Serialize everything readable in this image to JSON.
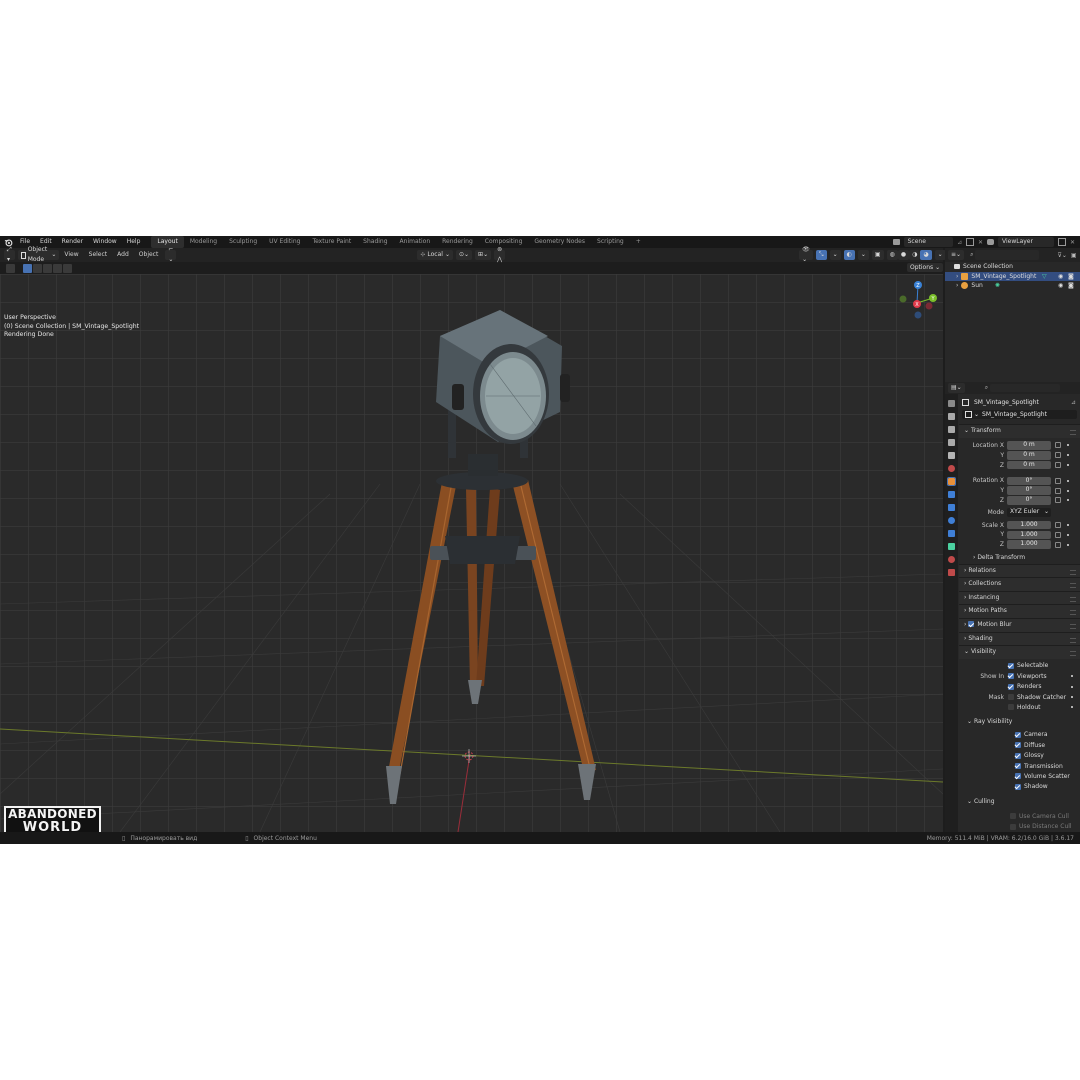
{
  "menubar": {
    "items": [
      "File",
      "Edit",
      "Render",
      "Window",
      "Help"
    ],
    "workspaces": [
      "Layout",
      "Modeling",
      "Sculpting",
      "UV Editing",
      "Texture Paint",
      "Shading",
      "Animation",
      "Rendering",
      "Compositing",
      "Geometry Nodes",
      "Scripting"
    ],
    "active_workspace": "Layout",
    "plus": "+",
    "scene": "Scene",
    "view_layer": "ViewLayer"
  },
  "viewport_header": {
    "mode": "Object Mode",
    "menus": [
      "View",
      "Select",
      "Add",
      "Object"
    ],
    "pivot": "Local",
    "options": "Options"
  },
  "viewport_info": {
    "line1": "User Perspective",
    "line2": "(0) Scene Collection | SM_Vintage_Spotlight",
    "line3": "Rendering Done"
  },
  "gizmo": {
    "z": "Z",
    "x": "X",
    "y": "Y"
  },
  "outliner": {
    "root": "Scene Collection",
    "items": [
      "SM_Vintage_Spotlight",
      "Sun"
    ]
  },
  "properties": {
    "object_name": "SM_Vintage_Spotlight",
    "object_field": "SM_Vintage_Spotlight",
    "transform_title": "Transform",
    "location_label": "Location X",
    "location": [
      "0 m",
      "0 m",
      "0 m"
    ],
    "rotation_label": "Rotation X",
    "rotation": [
      "0°",
      "0°",
      "0°"
    ],
    "axis_y": "Y",
    "axis_z": "Z",
    "mode_label": "Mode",
    "mode_value": "XYZ Euler",
    "scale_label": "Scale X",
    "scale": [
      "1.000",
      "1.000",
      "1.000"
    ],
    "delta_transform": "Delta Transform",
    "panels": [
      "Relations",
      "Collections",
      "Instancing",
      "Motion Paths",
      "Motion Blur",
      "Shading",
      "Visibility"
    ],
    "selectable": "Selectable",
    "show_in": "Show In",
    "viewports": "Viewports",
    "renders": "Renders",
    "mask": "Mask",
    "shadow_catcher": "Shadow Catcher",
    "holdout": "Holdout",
    "ray_visibility": "Ray Visibility",
    "rays": [
      "Camera",
      "Diffuse",
      "Glossy",
      "Transmission",
      "Volume Scatter",
      "Shadow"
    ],
    "culling": "Culling",
    "use_camera_cull": "Use Camera Cull",
    "use_distance_cull": "Use Distance Cull"
  },
  "statusbar": {
    "pan": "Панорамировать вид",
    "context": "Object Context Menu",
    "memory": "Memory: 511.4 MiB | VRAM: 6.2/16.0 GiB | 3.6.17"
  },
  "watermark": {
    "line1": "ABANDONED",
    "line2": "WORLD"
  },
  "colors": {
    "accent": "#4772b3",
    "x_axis": "#e03a4a",
    "y_axis": "#7bbf2a",
    "z_axis": "#3a82d6"
  }
}
